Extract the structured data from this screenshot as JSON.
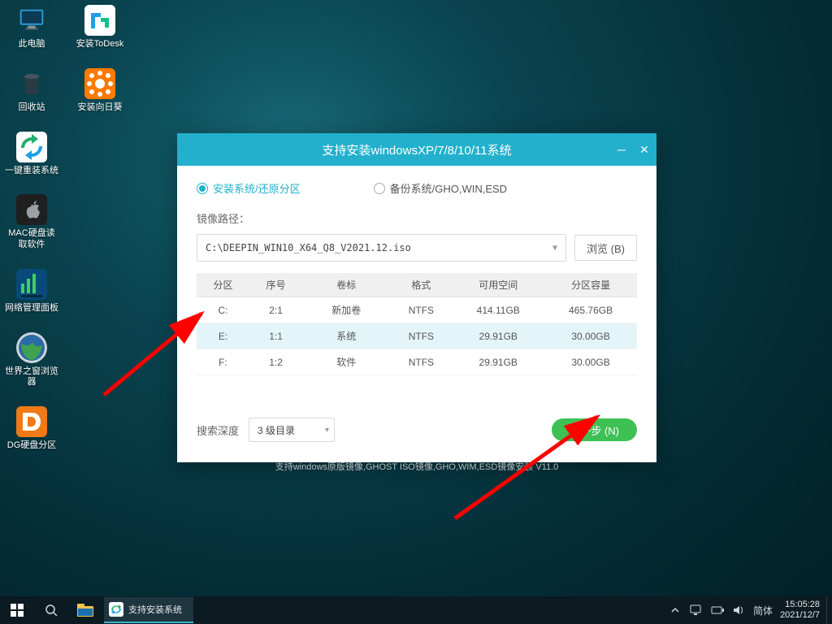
{
  "desktop_icons": {
    "this_pc": "此电脑",
    "todesk": "安装ToDesk",
    "recycle": "回收站",
    "sunflower": "安装向日葵",
    "reinstall": "一键重装系统",
    "macread": "MAC硬盘读\n取软件",
    "netpanel": "网络管理面板",
    "worldbrowser": "世界之窗浏览\n器",
    "dg": "DG硬盘分区"
  },
  "dialog": {
    "title": "支持安装windowsXP/7/8/10/11系统",
    "radio_install": "安装系统/还原分区",
    "radio_backup": "备份系统/GHO,WIN,ESD",
    "path_label": "镜像路径：",
    "path_value": "C:\\DEEPIN_WIN10_X64_Q8_V2021.12.iso",
    "browse": "浏览 (B)",
    "table": {
      "headers": {
        "part": "分区",
        "seq": "序号",
        "label": "卷标",
        "format": "格式",
        "free": "可用空间",
        "cap": "分区容量"
      },
      "rows": [
        {
          "part": "C:",
          "seq": "2:1",
          "label": "新加卷",
          "format": "NTFS",
          "free": "414.11GB",
          "cap": "465.76GB"
        },
        {
          "part": "E:",
          "seq": "1:1",
          "label": "系统",
          "format": "NTFS",
          "free": "29.91GB",
          "cap": "30.00GB"
        },
        {
          "part": "F:",
          "seq": "1:2",
          "label": "软件",
          "format": "NTFS",
          "free": "29.91GB",
          "cap": "30.00GB"
        }
      ]
    },
    "search_depth_label": "搜索深度",
    "search_depth_value": "3 级目录",
    "next": "下一步 (N)",
    "footnote": "支持windows原版镜像,GHOST ISO镜像,GHO,WIM,ESD镜像安装 V11.0"
  },
  "taskbar": {
    "task_label": "支持安装系统",
    "ime": "简体",
    "time": "15:05:28",
    "date": "2021/12/7"
  }
}
